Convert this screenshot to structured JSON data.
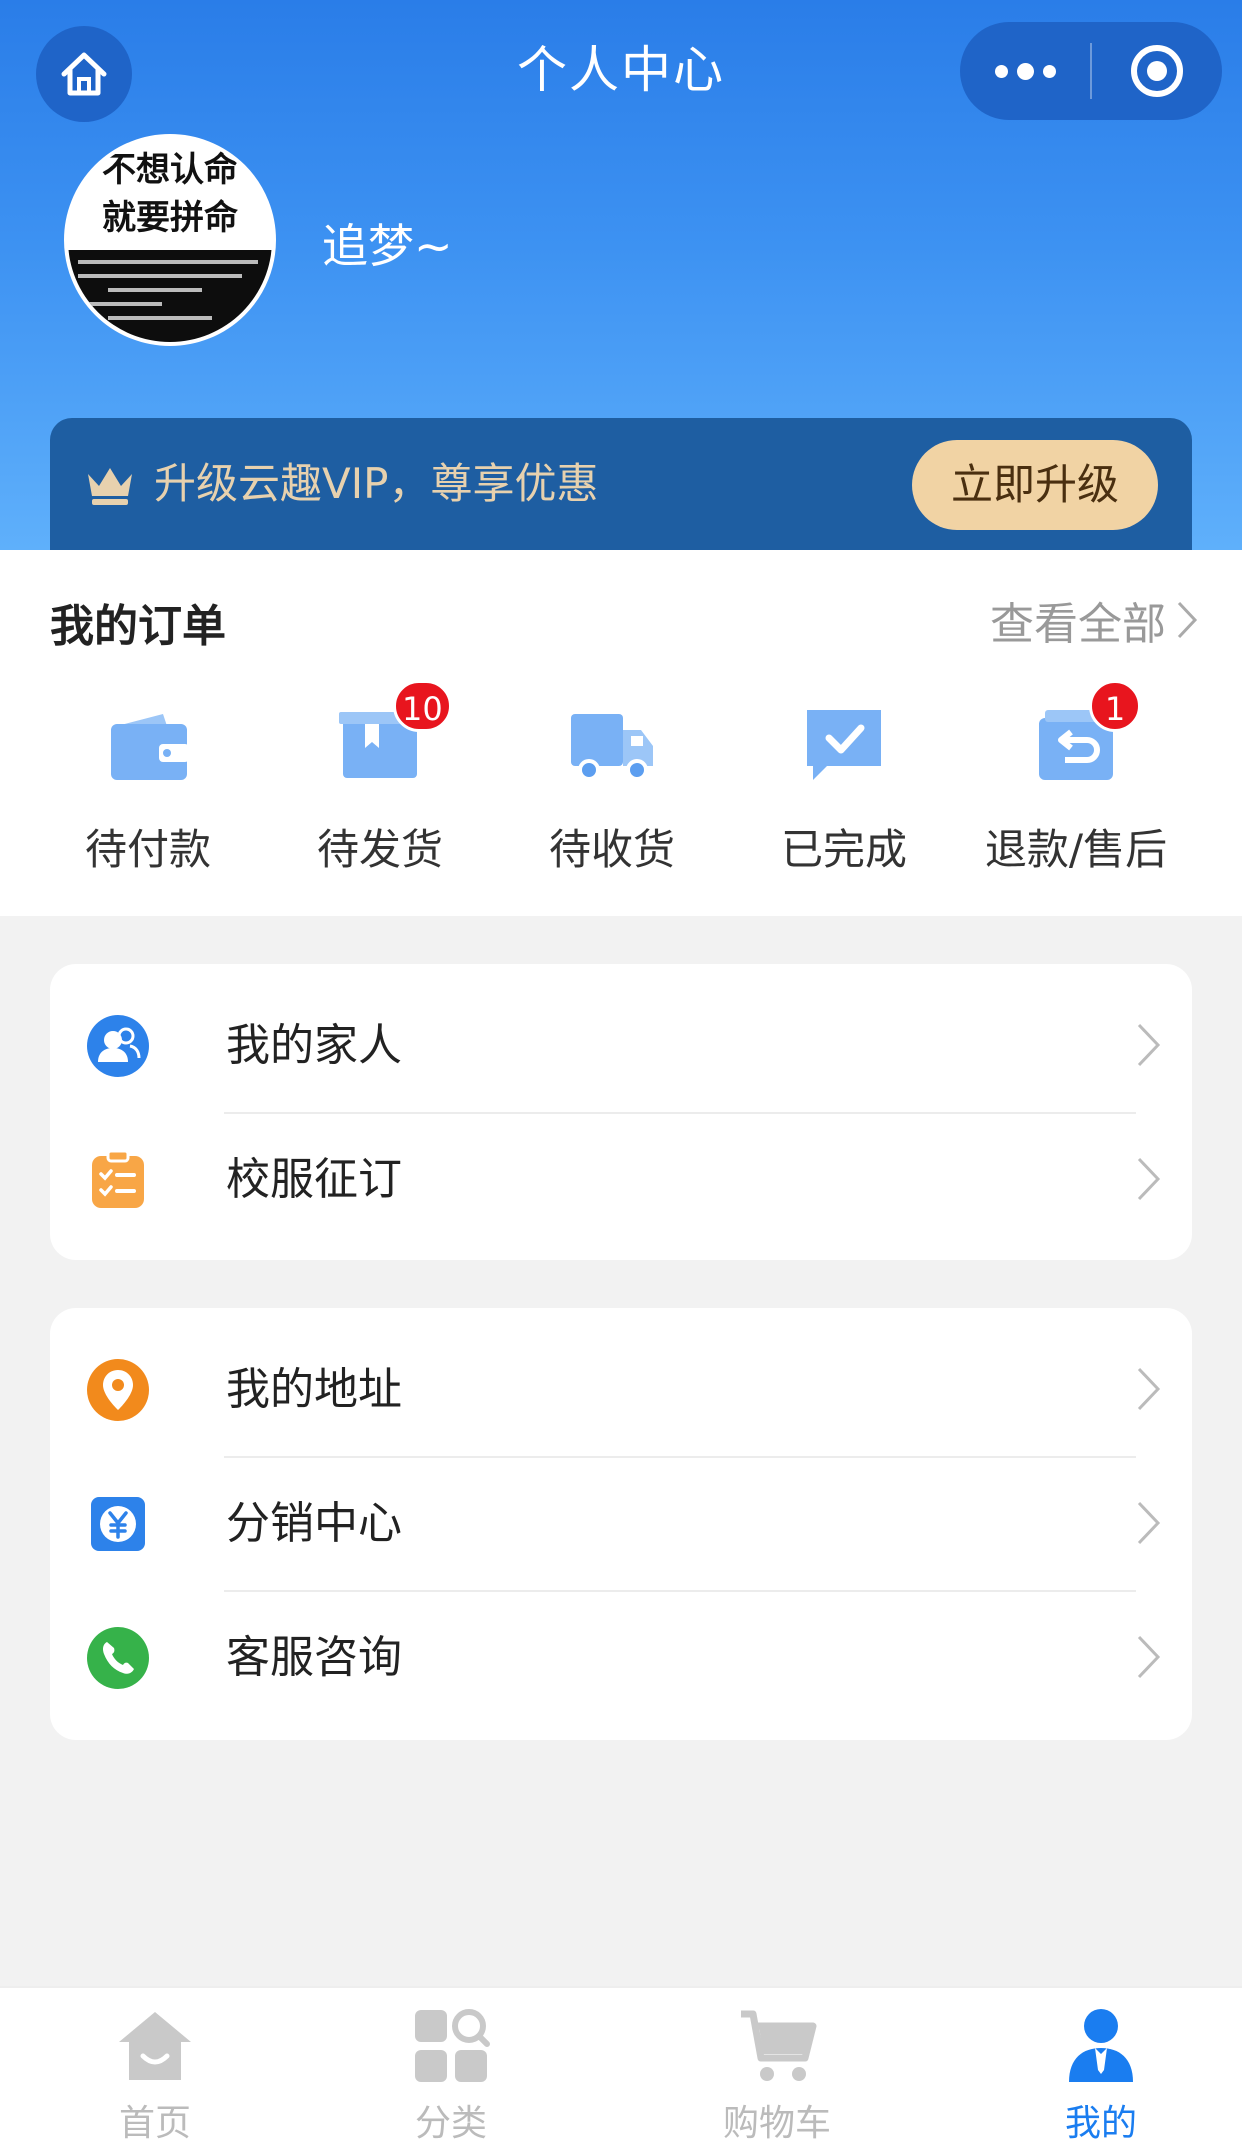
{
  "header": {
    "title": "个人中心",
    "username": "追梦~",
    "avatar_text_line1": "不想认命",
    "avatar_text_line2": "就要拼命"
  },
  "vip": {
    "text": "升级云趣VIP，尊享优惠",
    "button": "立即升级"
  },
  "orders": {
    "title": "我的订单",
    "view_all": "查看全部",
    "items": [
      {
        "label": "待付款",
        "icon": "wallet-icon",
        "badge": ""
      },
      {
        "label": "待发货",
        "icon": "package-icon",
        "badge": "10"
      },
      {
        "label": "待收货",
        "icon": "truck-icon",
        "badge": ""
      },
      {
        "label": "已完成",
        "icon": "check-message-icon",
        "badge": ""
      },
      {
        "label": "退款/售后",
        "icon": "return-icon",
        "badge": "1"
      }
    ]
  },
  "menu1": [
    {
      "label": "我的家人",
      "icon": "family-icon"
    },
    {
      "label": "校服征订",
      "icon": "clipboard-icon"
    }
  ],
  "menu2": [
    {
      "label": "我的地址",
      "icon": "location-pin-icon"
    },
    {
      "label": "分销中心",
      "icon": "yuan-icon"
    },
    {
      "label": "客服咨询",
      "icon": "phone-icon"
    }
  ],
  "tabbar": [
    {
      "label": "首页",
      "icon": "home-icon",
      "active": false
    },
    {
      "label": "分类",
      "icon": "category-icon",
      "active": false
    },
    {
      "label": "购物车",
      "icon": "cart-icon",
      "active": false
    },
    {
      "label": "我的",
      "icon": "user-icon",
      "active": true
    }
  ],
  "colors": {
    "primary": "#1a7df0",
    "badge": "#e8151e",
    "vip_gold": "#f1d3a4"
  }
}
